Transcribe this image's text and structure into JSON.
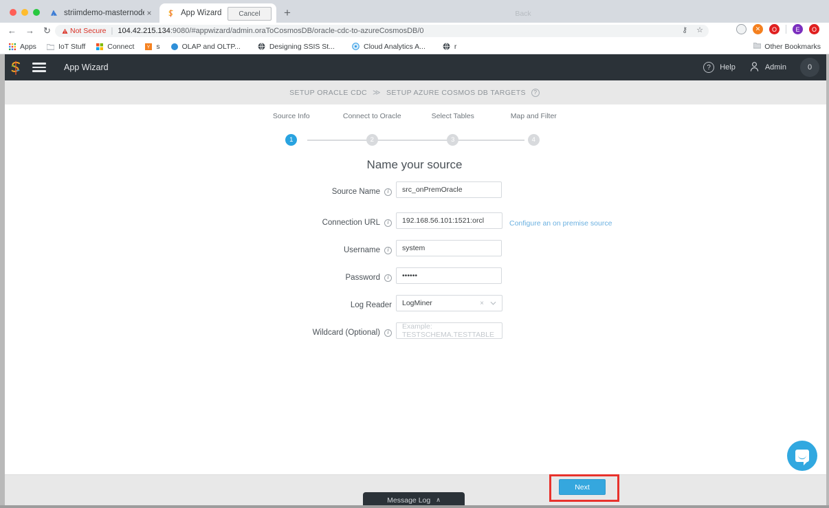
{
  "browser": {
    "tabs": [
      {
        "title": "striimdemo-masternode - Micr",
        "favicon": "azure-icon",
        "active": false,
        "close": "×"
      },
      {
        "title": "App Wizard",
        "favicon": "striim-icon",
        "active": true,
        "close": "×"
      }
    ],
    "new_tab": "+",
    "nav": {
      "back": "←",
      "forward": "→",
      "reload": "↻"
    },
    "url": {
      "security_label": "Not Secure",
      "security_icon": "warning-triangle-icon",
      "host": "104.42.215.134",
      "rest": ":9080/#appwizard/admin.oraToCosmosDB/oracle-cdc-to-azureCosmosDB/0"
    },
    "omnibox_icons": [
      {
        "name": "key-icon",
        "glyph": "⚷"
      },
      {
        "name": "bookmark-star-icon",
        "glyph": "☆"
      }
    ],
    "extensions": [
      {
        "name": "extension-globe-icon",
        "glyph": "○",
        "color": "#f1f3f4",
        "fg": "#5f6368"
      },
      {
        "name": "extension-orange-icon",
        "glyph": "✖",
        "color": "#f4801f",
        "fg": "#ffffff"
      },
      {
        "name": "extension-red-icon",
        "glyph": "●",
        "color": "#e02020",
        "fg": "#ffffff"
      },
      {
        "name": "profile-avatar-icon",
        "glyph": "E",
        "color": "#7b2fbe",
        "fg": "#ffffff"
      },
      {
        "name": "extension-red2-icon",
        "glyph": "●",
        "color": "#e02020",
        "fg": "#ffffff"
      }
    ],
    "bookmarks": [
      {
        "label": "Apps",
        "icon": "apps-grid-icon"
      },
      {
        "label": "IoT Stuff",
        "icon": "folder-icon"
      },
      {
        "label": "Connect",
        "icon": "microsoft-icon"
      },
      {
        "label": "s",
        "icon": "yellow-y-icon"
      },
      {
        "label": "OLAP and OLTP...",
        "icon": "blue-circle-icon"
      },
      {
        "label": "Designing SSIS St...",
        "icon": "globe-icon"
      },
      {
        "label": "Cloud Analytics A...",
        "icon": "blue-ring-icon"
      },
      {
        "label": "r",
        "icon": "globe-icon"
      }
    ],
    "other_bookmarks": {
      "label": "Other Bookmarks",
      "icon": "folder-icon"
    }
  },
  "appbar": {
    "logo": "striim-logo-icon",
    "menu_icon": "hamburger-icon",
    "title": "App Wizard",
    "help": {
      "label": "Help",
      "icon": "question-circle-icon"
    },
    "user": {
      "label": "Admin",
      "icon": "user-icon"
    },
    "notification_count": "0"
  },
  "breadcrumb": {
    "items": [
      "SETUP ORACLE CDC",
      "SETUP AZURE COSMOS DB TARGETS"
    ],
    "separator": "≫",
    "help_icon": "question-circle-icon"
  },
  "stepper": {
    "steps": [
      {
        "number": "1",
        "label": "Source Info",
        "active": true
      },
      {
        "number": "2",
        "label": "Connect to Oracle",
        "active": false
      },
      {
        "number": "3",
        "label": "Select Tables",
        "active": false
      },
      {
        "number": "4",
        "label": "Map and Filter",
        "active": false
      }
    ],
    "active_color": "#29a3e0",
    "inactive_color": "#d8dadd"
  },
  "form": {
    "title": "Name your source",
    "fields": [
      {
        "label": "Source Name",
        "has_info": true,
        "value": "src_onPremOracle",
        "placeholder": "",
        "type": "text"
      },
      {
        "label": "Connection URL",
        "has_info": true,
        "value": "192.168.56.101:1521:orcl",
        "placeholder": "",
        "type": "text"
      },
      {
        "label": "Username",
        "has_info": true,
        "value": "system",
        "placeholder": "",
        "type": "text"
      },
      {
        "label": "Password",
        "has_info": true,
        "value": "••••••",
        "placeholder": "",
        "type": "password"
      },
      {
        "label": "Log Reader",
        "has_info": false,
        "value": "LogMiner",
        "placeholder": "",
        "type": "select"
      },
      {
        "label": "Wildcard (Optional)",
        "has_info": true,
        "value": "",
        "placeholder": "Example: TESTSCHEMA.TESTTABLE",
        "type": "text"
      }
    ],
    "help_link": "Configure an on premise source",
    "select_clear_icon": "×",
    "select_chevron_icon": "⌄"
  },
  "chat_widget": {
    "icon": "chat-bubble-icon",
    "color": "#31a8e0"
  },
  "footer": {
    "cancel_label": "Cancel",
    "back_label": "Back",
    "next_label": "Next",
    "next_color": "#35a7de",
    "highlight_color": "#e8322c",
    "message_log_label": "Message Log",
    "message_log_caret": "∧"
  }
}
